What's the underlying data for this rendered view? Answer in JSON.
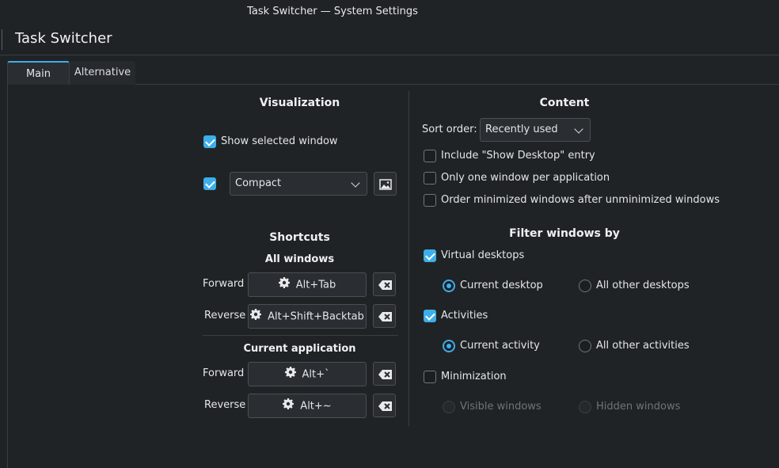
{
  "window": {
    "title": "Task Switcher — System Settings"
  },
  "header": {
    "title": "Task Switcher"
  },
  "tabs": [
    {
      "label": "Main",
      "active": true
    },
    {
      "label": "Alternative",
      "active": false
    }
  ],
  "visualization": {
    "heading": "Visualization",
    "show_selected_window": {
      "label": "Show selected window",
      "checked": true
    },
    "layout_enabled": true,
    "layout_combo": {
      "value": "Compact"
    },
    "preview_button_icon": "image-icon"
  },
  "shortcuts": {
    "heading": "Shortcuts",
    "all_windows": {
      "heading": "All windows",
      "forward": {
        "label": "Forward",
        "key": "Alt+Tab"
      },
      "reverse": {
        "label": "Reverse",
        "key": "Alt+Shift+Backtab"
      }
    },
    "current_application": {
      "heading": "Current application",
      "forward": {
        "label": "Forward",
        "key": "Alt+`"
      },
      "reverse": {
        "label": "Reverse",
        "key": "Alt+~"
      }
    }
  },
  "content": {
    "heading": "Content",
    "sort_order": {
      "label": "Sort order:",
      "value": "Recently used"
    },
    "include_show_desktop": {
      "label": "Include \"Show Desktop\" entry",
      "checked": false
    },
    "one_window_per_app": {
      "label": "Only one window per application",
      "checked": false
    },
    "order_minimized": {
      "label": "Order minimized windows after unminimized windows",
      "checked": false
    }
  },
  "filter": {
    "heading": "Filter windows by",
    "virtual_desktops": {
      "label": "Virtual desktops",
      "checked": true,
      "options": [
        {
          "label": "Current desktop",
          "selected": true
        },
        {
          "label": "All other desktops",
          "selected": false
        }
      ]
    },
    "activities": {
      "label": "Activities",
      "checked": true,
      "options": [
        {
          "label": "Current activity",
          "selected": true
        },
        {
          "label": "All other activities",
          "selected": false
        }
      ]
    },
    "minimization": {
      "label": "Minimization",
      "checked": false,
      "options": [
        {
          "label": "Visible windows",
          "selected": false
        },
        {
          "label": "Hidden windows",
          "selected": false
        }
      ]
    }
  },
  "colors": {
    "accent": "#3daee9",
    "background": "#202326",
    "button": "#2a2e32"
  }
}
